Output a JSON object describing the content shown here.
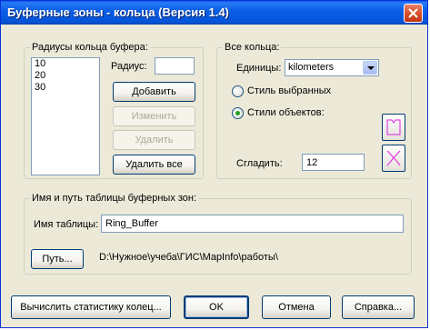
{
  "window": {
    "title": "Буферные зоны - кольца (Версия 1.4)"
  },
  "radii_group": {
    "title": "Радиусы кольца буфера:",
    "items": [
      "10",
      "20",
      "30"
    ],
    "radius_label": "Радиус:",
    "radius_value": "",
    "buttons": {
      "add": "Добавить",
      "edit": "Изменить",
      "delete": "Удалить",
      "delete_all": "Удалить все"
    }
  },
  "all_rings_group": {
    "title": "Все кольца:",
    "units_label": "Единицы:",
    "units_value": "kilometers",
    "option_selected_style": "Стиль выбранных",
    "option_object_styles": "Стили объектов:",
    "object_styles_checked": true,
    "smooth_label": "Сгладить:",
    "smooth_value": "12"
  },
  "table_group": {
    "title": "Имя и путь таблицы буферных зон:",
    "table_name_label": "Имя таблицы:",
    "table_name_value": "Ring_Buffer",
    "path_button": "Путь...",
    "path_value": "D:\\Нужное\\учеба\\ГИС\\MapInfo\\работы\\"
  },
  "footer": {
    "stats_button": "Вычислить статистику колец...",
    "ok_button": "OK",
    "cancel_button": "Отмена",
    "help_button": "Справка..."
  },
  "icons": {
    "region_style": "region-style-icon",
    "line_style": "line-style-icon",
    "style_color": "#e020e0"
  }
}
